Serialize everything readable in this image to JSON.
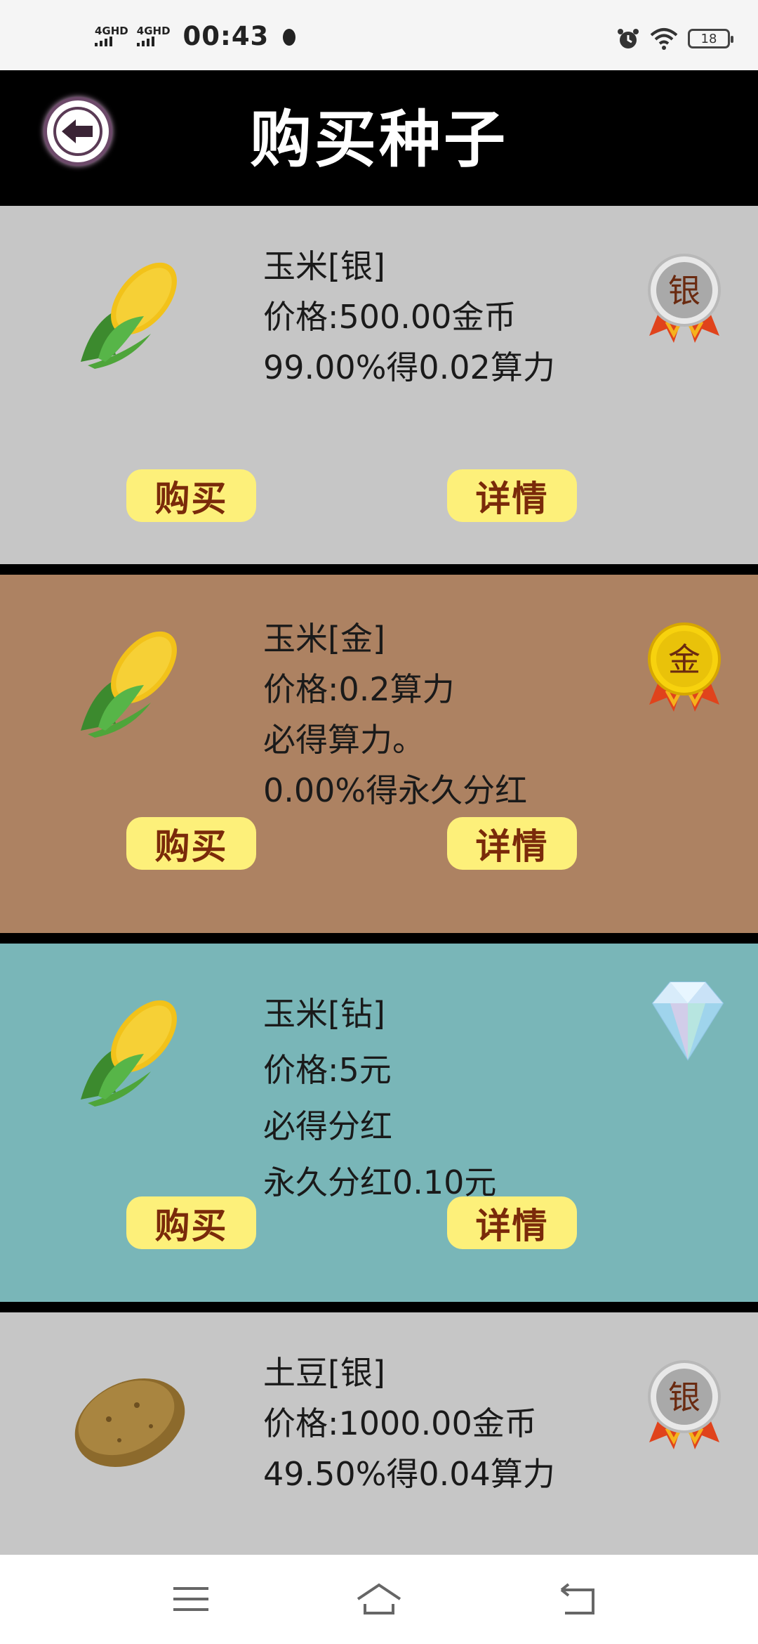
{
  "status_bar": {
    "net1": "4GHD",
    "net2": "4GHD",
    "time": "00:43",
    "battery": "18"
  },
  "header": {
    "title": "购买种子"
  },
  "cards": [
    {
      "name": "玉米[银]",
      "lines": [
        "价格:500.00金币",
        "99.00%得0.02算力"
      ],
      "medal": "银",
      "buy_label": "购买",
      "detail_label": "详情"
    },
    {
      "name": "玉米[金]",
      "lines": [
        "价格:0.2算力",
        "必得算力。",
        "0.00%得永久分红"
      ],
      "medal": "金",
      "buy_label": "购买",
      "detail_label": "详情"
    },
    {
      "name": "玉米[钻]",
      "lines": [
        "价格:5元",
        "必得分红",
        "永久分红0.10元"
      ],
      "medal": "diamond-icon",
      "buy_label": "购买",
      "detail_label": "详情"
    },
    {
      "name": "土豆[银]",
      "lines": [
        "价格:1000.00金币",
        "49.50%得0.04算力"
      ],
      "medal": "银"
    }
  ],
  "colors": {
    "silver_card": "#c6c6c6",
    "gold_card": "#ad8262",
    "diamond_card": "#79b6b8",
    "button_bg": "#fdf07a",
    "button_text": "#7a2a0a"
  }
}
